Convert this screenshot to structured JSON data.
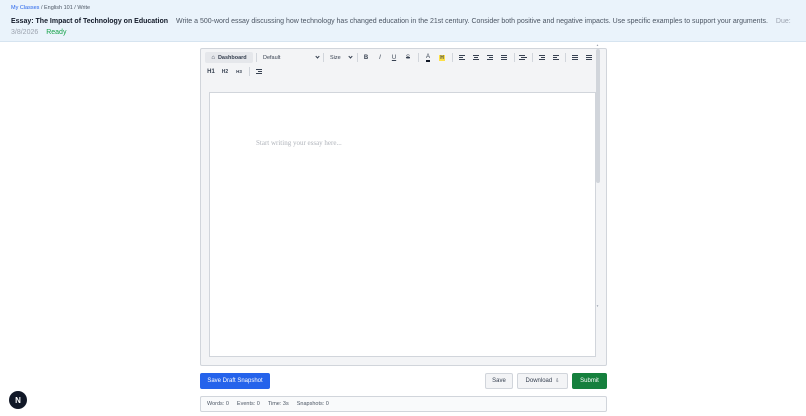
{
  "breadcrumb": {
    "classes": "My Classes",
    "course": "English 101",
    "current": "Write",
    "sep": "/"
  },
  "assignment": {
    "title": "Essay: The Impact of Technology on Education",
    "description": "Write a 500-word essay discussing how technology has changed education in the 21st century. Consider both positive and negative impacts. Use specific examples to support your arguments.",
    "due": "Due: 3/8/2026",
    "status": "Ready"
  },
  "toolbar": {
    "dashboard_label": "Dashboard",
    "font_value": "Default",
    "size_value": "Size",
    "bold": "B",
    "italic": "I",
    "underline": "U",
    "strike": "S",
    "color_label": "A",
    "highlight_label": "H",
    "h1": "H1",
    "h2": "H2",
    "h3": "H3"
  },
  "editor": {
    "placeholder": "Start writing your essay here..."
  },
  "actions": {
    "snapshot": "Save Draft Snapshot",
    "save": "Save",
    "download": "Download",
    "submit": "Submit"
  },
  "stats": {
    "words": "Words: 0",
    "events": "Events: 0",
    "time": "Time: 3s",
    "snapshots": "Snapshots: 0"
  },
  "fab_label": "N"
}
